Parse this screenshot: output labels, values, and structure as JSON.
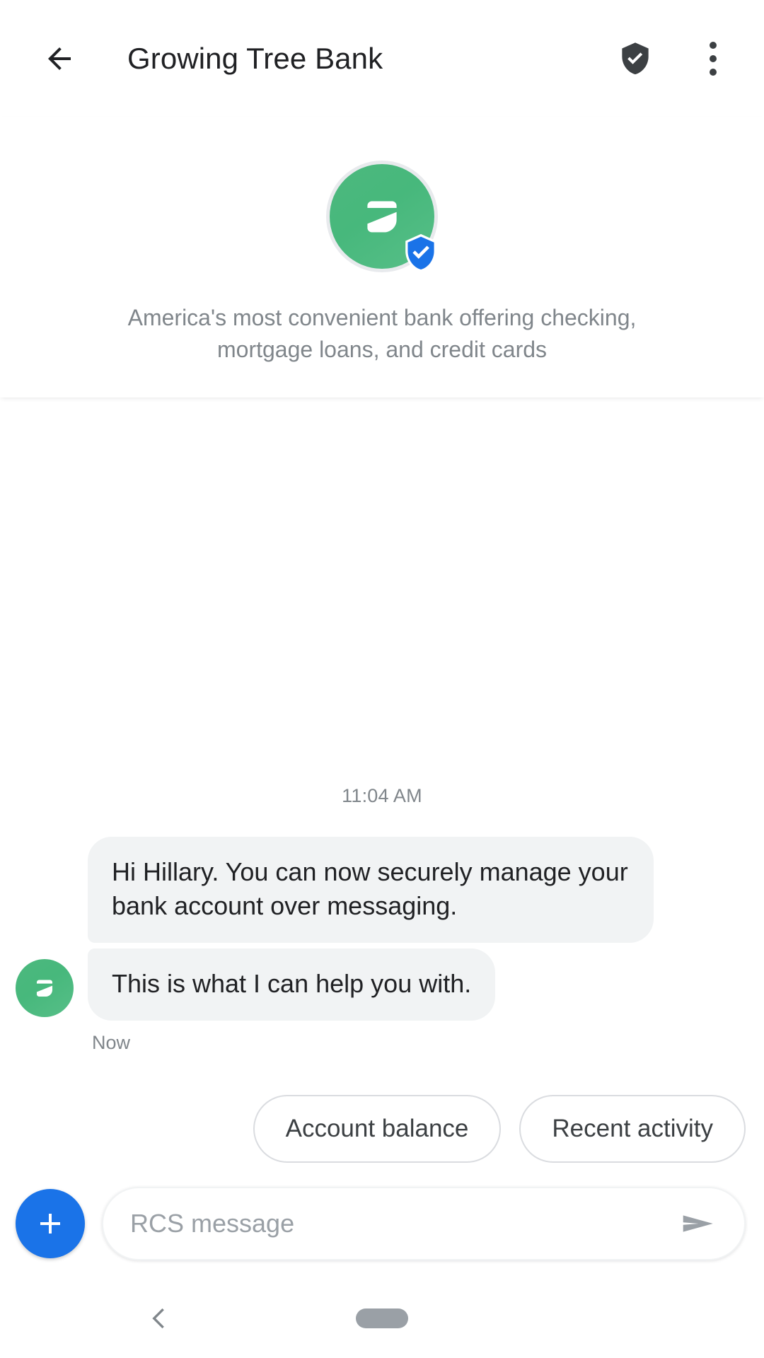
{
  "appbar": {
    "back_icon": "arrow-left-icon",
    "title": "Growing Tree Bank",
    "verified_icon": "shield-check-icon",
    "overflow_icon": "more-vert-icon"
  },
  "bot_header": {
    "avatar_icon": "leaf-logo-icon",
    "verified_badge_icon": "shield-check-badge-icon",
    "description": "America's most convenient bank offering checking, mortgage loans, and credit cards",
    "brand_green": "#47b87c",
    "badge_blue": "#1a73e8"
  },
  "thread": {
    "day_stamp": "11:04 AM",
    "avatar_icon": "leaf-logo-icon",
    "messages": [
      {
        "text": "Hi Hillary. You can now securely manage your bank account over messaging."
      },
      {
        "text": "This is what I can help you with."
      }
    ],
    "message_time": "Now",
    "bubble_bg": "#f1f3f4"
  },
  "suggestions": {
    "chips": [
      {
        "label": "Account balance"
      },
      {
        "label": "Recent activity"
      }
    ]
  },
  "composer": {
    "plus_icon": "plus-icon",
    "placeholder": "RCS message",
    "value": "",
    "send_icon": "send-icon",
    "fab_color": "#1a73e8"
  },
  "sysnav": {
    "back_icon": "chevron-left-icon",
    "home_icon": "home-pill-icon"
  }
}
